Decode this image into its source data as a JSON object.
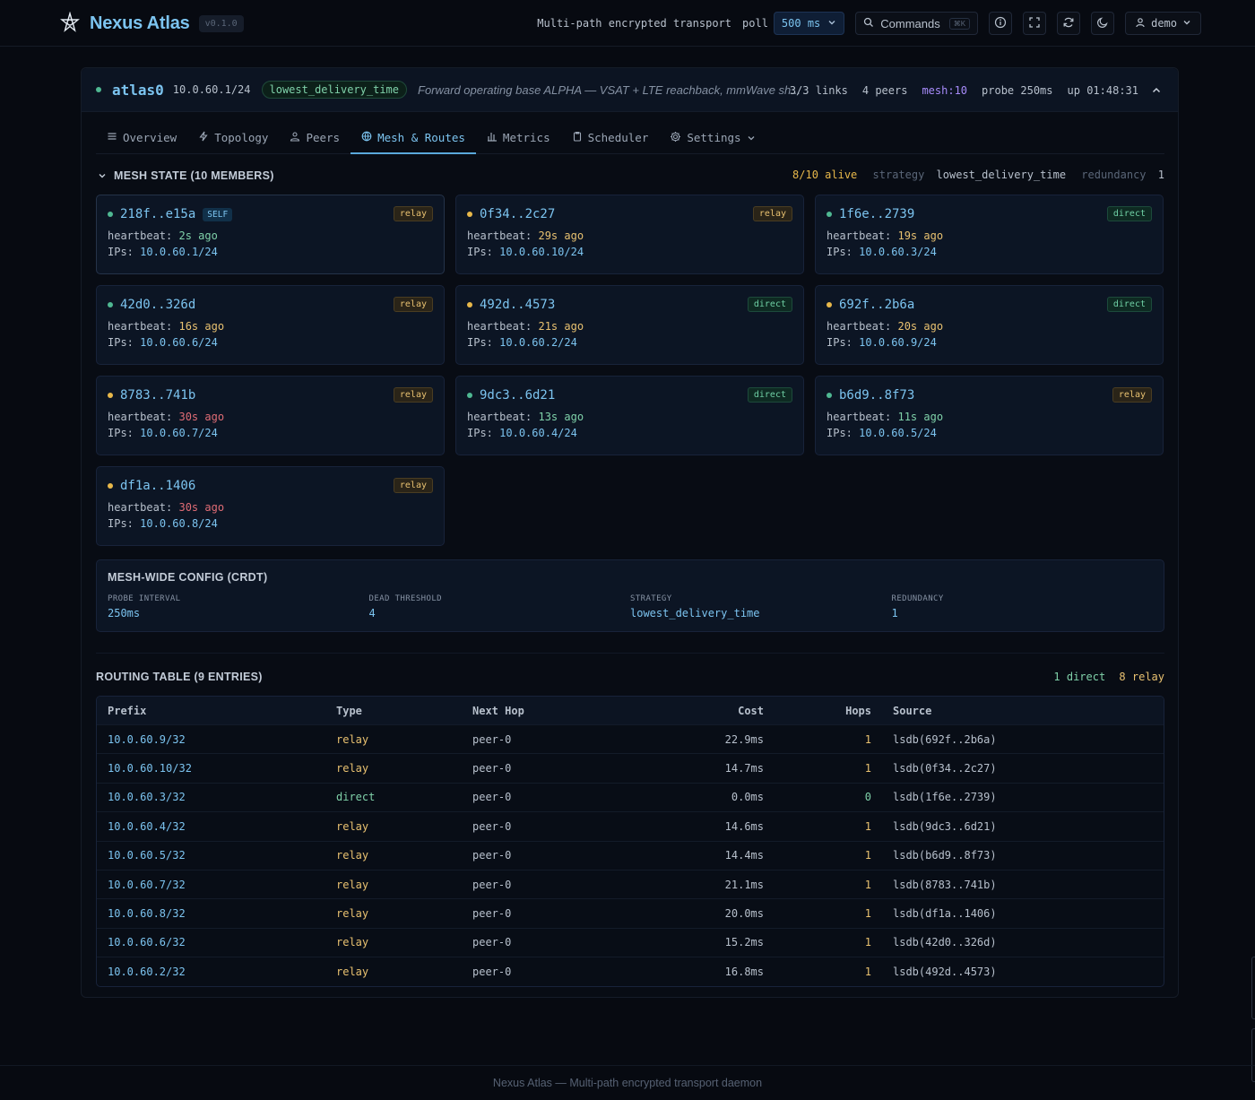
{
  "app": {
    "name": "Nexus Atlas",
    "version": "v0.1.0",
    "tagline": "Multi-path encrypted transport",
    "poll_label": "poll",
    "poll_value": "500 ms",
    "commands_label": "Commands",
    "commands_shortcut": "⌘K",
    "user": "demo",
    "icons": [
      "logo-icon",
      "search-icon",
      "info-icon",
      "fullscreen-icon",
      "refresh-icon",
      "moon-icon",
      "user-icon",
      "chevron-down-icon"
    ]
  },
  "interface": {
    "name": "atlas0",
    "cidr": "10.0.60.1/24",
    "strategy": "lowest_delivery_time",
    "description": "Forward operating base ALPHA — VSAT + LTE reachback, mmWave sh...",
    "links": "3/3 links",
    "peers": "4 peers",
    "mesh": "mesh:10",
    "probe": "probe 250ms",
    "uptime": "up 01:48:31"
  },
  "tabs": [
    {
      "label": "Overview",
      "icon": "list-icon"
    },
    {
      "label": "Topology",
      "icon": "bolt-icon"
    },
    {
      "label": "Peers",
      "icon": "users-icon"
    },
    {
      "label": "Mesh & Routes",
      "icon": "globe-icon",
      "active": true
    },
    {
      "label": "Metrics",
      "icon": "bar-chart-icon"
    },
    {
      "label": "Scheduler",
      "icon": "clipboard-icon"
    },
    {
      "label": "Settings",
      "icon": "gear-icon"
    }
  ],
  "mesh": {
    "title": "MESH STATE (10 MEMBERS)",
    "alive": "8/10 alive",
    "strategy_label": "strategy",
    "strategy_value": "lowest_delivery_time",
    "redundancy_label": "redundancy",
    "redundancy_value": "1",
    "heartbeat_label": "heartbeat:",
    "ips_label": "IPs:",
    "self_label": "SELF",
    "members": [
      {
        "id": "218f..e15a",
        "self": true,
        "status": "green",
        "role": "relay",
        "heartbeat": "2s ago",
        "hb_level": "g",
        "ip": "10.0.60.1/24"
      },
      {
        "id": "0f34..2c27",
        "status": "yellow",
        "role": "relay",
        "heartbeat": "29s ago",
        "hb_level": "y",
        "ip": "10.0.60.10/24"
      },
      {
        "id": "1f6e..2739",
        "status": "green",
        "role": "direct",
        "heartbeat": "19s ago",
        "hb_level": "y",
        "ip": "10.0.60.3/24"
      },
      {
        "id": "42d0..326d",
        "status": "green",
        "role": "relay",
        "heartbeat": "16s ago",
        "hb_level": "y",
        "ip": "10.0.60.6/24"
      },
      {
        "id": "492d..4573",
        "status": "yellow",
        "role": "direct",
        "heartbeat": "21s ago",
        "hb_level": "y",
        "ip": "10.0.60.2/24"
      },
      {
        "id": "692f..2b6a",
        "status": "yellow",
        "role": "direct",
        "heartbeat": "20s ago",
        "hb_level": "y",
        "ip": "10.0.60.9/24"
      },
      {
        "id": "8783..741b",
        "status": "yellow",
        "role": "relay",
        "heartbeat": "30s ago",
        "hb_level": "r",
        "ip": "10.0.60.7/24"
      },
      {
        "id": "9dc3..6d21",
        "status": "green",
        "role": "direct",
        "heartbeat": "13s ago",
        "hb_level": "g",
        "ip": "10.0.60.4/24"
      },
      {
        "id": "b6d9..8f73",
        "status": "green",
        "role": "relay",
        "heartbeat": "11s ago",
        "hb_level": "g",
        "ip": "10.0.60.5/24"
      },
      {
        "id": "df1a..1406",
        "status": "yellow",
        "role": "relay",
        "heartbeat": "30s ago",
        "hb_level": "r",
        "ip": "10.0.60.8/24"
      }
    ]
  },
  "config": {
    "title": "MESH-WIDE CONFIG (CRDT)",
    "items": [
      {
        "label": "PROBE INTERVAL",
        "value": "250ms"
      },
      {
        "label": "DEAD THRESHOLD",
        "value": "4"
      },
      {
        "label": "STRATEGY",
        "value": "lowest_delivery_time"
      },
      {
        "label": "REDUNDANCY",
        "value": "1"
      }
    ]
  },
  "routes": {
    "title": "ROUTING TABLE (9 ENTRIES)",
    "direct_count": "1 direct",
    "relay_count": "8 relay",
    "columns": [
      "Prefix",
      "Type",
      "Next Hop",
      "Cost",
      "Hops",
      "Source"
    ],
    "rows": [
      {
        "prefix": "10.0.60.9/32",
        "type": "relay",
        "next_hop": "peer-0",
        "cost": "22.9ms",
        "hops": "1",
        "source": "lsdb(692f..2b6a)"
      },
      {
        "prefix": "10.0.60.10/32",
        "type": "relay",
        "next_hop": "peer-0",
        "cost": "14.7ms",
        "hops": "1",
        "source": "lsdb(0f34..2c27)"
      },
      {
        "prefix": "10.0.60.3/32",
        "type": "direct",
        "next_hop": "peer-0",
        "cost": "0.0ms",
        "hops": "0",
        "source": "lsdb(1f6e..2739)"
      },
      {
        "prefix": "10.0.60.4/32",
        "type": "relay",
        "next_hop": "peer-0",
        "cost": "14.6ms",
        "hops": "1",
        "source": "lsdb(9dc3..6d21)"
      },
      {
        "prefix": "10.0.60.5/32",
        "type": "relay",
        "next_hop": "peer-0",
        "cost": "14.4ms",
        "hops": "1",
        "source": "lsdb(b6d9..8f73)"
      },
      {
        "prefix": "10.0.60.7/32",
        "type": "relay",
        "next_hop": "peer-0",
        "cost": "21.1ms",
        "hops": "1",
        "source": "lsdb(8783..741b)"
      },
      {
        "prefix": "10.0.60.8/32",
        "type": "relay",
        "next_hop": "peer-0",
        "cost": "20.0ms",
        "hops": "1",
        "source": "lsdb(df1a..1406)"
      },
      {
        "prefix": "10.0.60.6/32",
        "type": "relay",
        "next_hop": "peer-0",
        "cost": "15.2ms",
        "hops": "1",
        "source": "lsdb(42d0..326d)"
      },
      {
        "prefix": "10.0.60.2/32",
        "type": "relay",
        "next_hop": "peer-0",
        "cost": "16.8ms",
        "hops": "1",
        "source": "lsdb(492d..4573)"
      }
    ]
  },
  "footer": "Nexus Atlas — Multi-path encrypted transport daemon",
  "colors": {
    "accent": "#7cc4f0",
    "relay": "#e8c170",
    "direct": "#7fd1a9",
    "stale": "#e06c75",
    "mesh": "#a78bfa"
  }
}
